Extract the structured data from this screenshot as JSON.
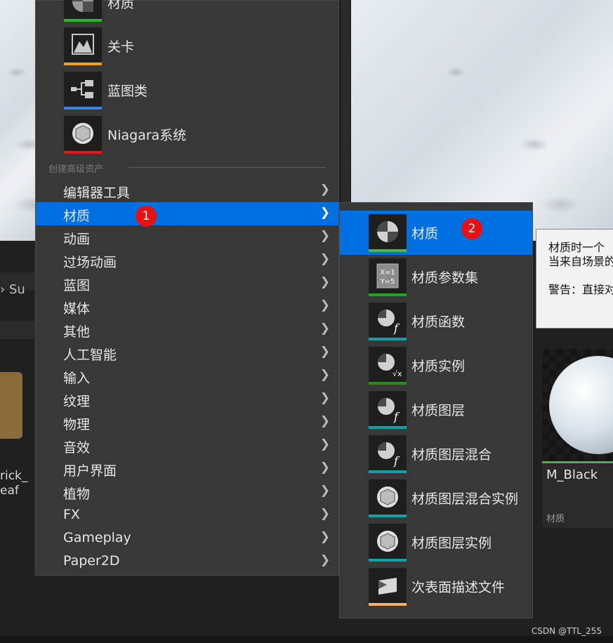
{
  "colors": {
    "highlight": "#0070e0",
    "badge": "#e81010",
    "menu_bg": "#383838"
  },
  "menu": {
    "asset_entries": [
      {
        "label": "材质",
        "icon": "material-icon",
        "bar_color": "#2fb52f"
      },
      {
        "label": "关卡",
        "icon": "level-icon",
        "bar_color": "#f0a020"
      },
      {
        "label": "蓝图类",
        "icon": "blueprint-icon",
        "bar_color": "#3f7ee8"
      },
      {
        "label": "Niagara系统",
        "icon": "niagara-icon",
        "bar_color": "#e01818"
      }
    ],
    "section_label": "创建高级资产",
    "categories": [
      {
        "label": "编辑器工具"
      },
      {
        "label": "材质"
      },
      {
        "label": "动画"
      },
      {
        "label": "过场动画"
      },
      {
        "label": "蓝图"
      },
      {
        "label": "媒体"
      },
      {
        "label": "其他"
      },
      {
        "label": "人工智能"
      },
      {
        "label": "输入"
      },
      {
        "label": "纹理"
      },
      {
        "label": "物理"
      },
      {
        "label": "音效"
      },
      {
        "label": "用户界面"
      },
      {
        "label": "植物"
      },
      {
        "label": "FX"
      },
      {
        "label": "Gameplay"
      },
      {
        "label": "Paper2D"
      }
    ],
    "active_category": "材质"
  },
  "submenu": {
    "items": [
      {
        "label": "材质",
        "icon": "material-sphere-icon",
        "bar_color": "#3fbf3f"
      },
      {
        "label": "材质参数集",
        "icon": "parameter-collection-icon",
        "bar_color": "#1fa81f"
      },
      {
        "label": "材质函数",
        "icon": "material-function-icon",
        "bar_color": "#0fa3a8"
      },
      {
        "label": "材质实例",
        "icon": "material-instance-icon",
        "bar_color": "#1f8f1f"
      },
      {
        "label": "材质图层",
        "icon": "material-layer-icon",
        "bar_color": "#0fa3a8"
      },
      {
        "label": "材质图层混合",
        "icon": "material-layer-blend-icon",
        "bar_color": "#0fa3a8"
      },
      {
        "label": "材质图层混合实例",
        "icon": "layer-blend-instance-icon",
        "bar_color": "#0fa3a8"
      },
      {
        "label": "材质图层实例",
        "icon": "layer-instance-icon",
        "bar_color": "#0fa3a8"
      },
      {
        "label": "次表面描述文件",
        "icon": "subsurface-profile-icon",
        "bar_color": "#f0b070"
      }
    ],
    "active_item": "材质"
  },
  "badges": {
    "one": "1",
    "two": "2"
  },
  "tooltip": {
    "line1": "材质时一个",
    "line2": "当来自场景的",
    "line3": "警告：直接对"
  },
  "asset_card": {
    "name": "M_Black",
    "type": "材质"
  },
  "left_partial": {
    "crumb": "Su",
    "asset_label": "rick_\neaf"
  },
  "watermark": "CSDN @TTL_255"
}
